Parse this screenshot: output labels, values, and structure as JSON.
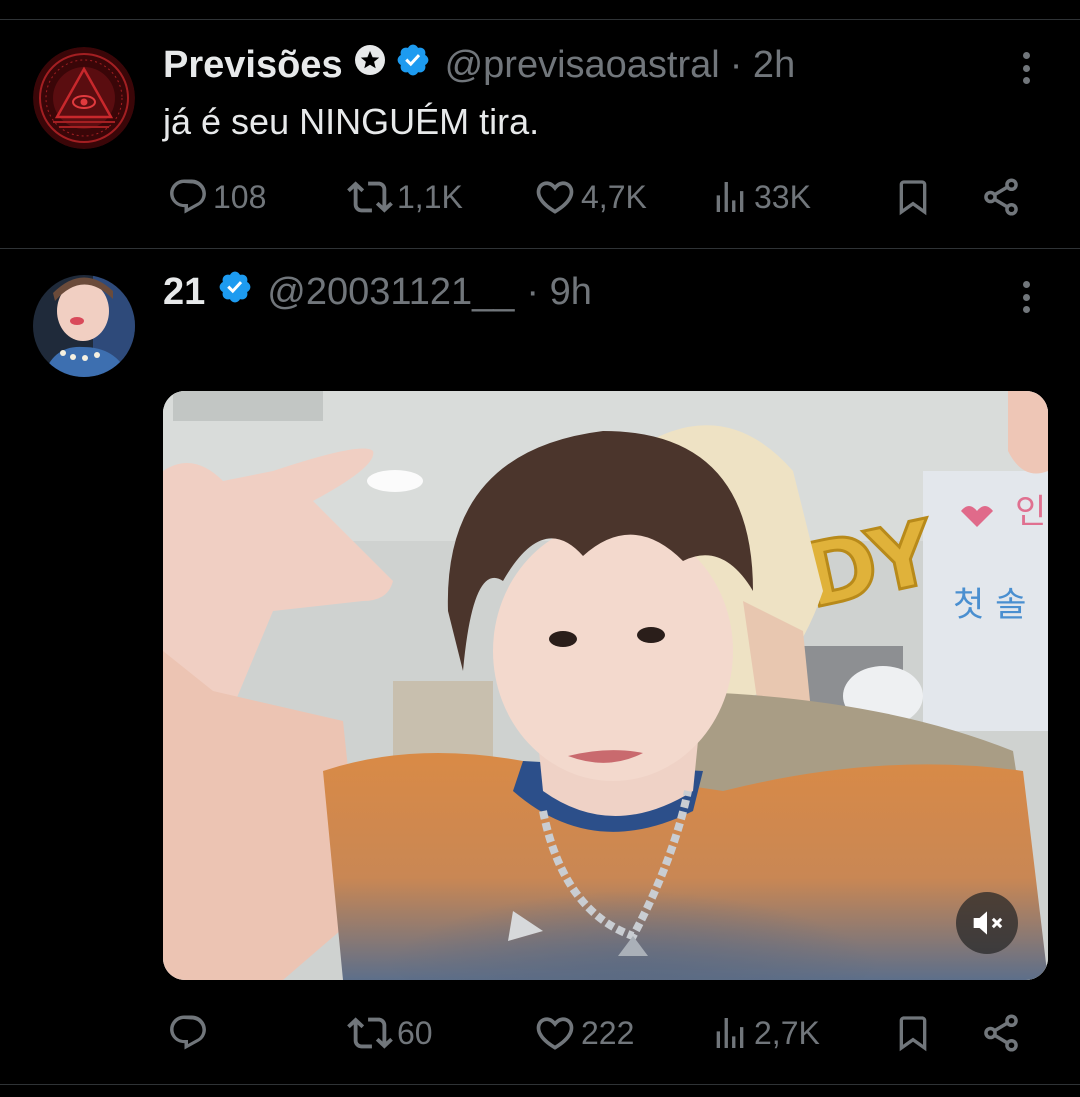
{
  "tweets": [
    {
      "author_name": "Previsões",
      "handle": "@previsaoastral",
      "time": "· 2h",
      "text": "já é seu NINGUÉM tira.",
      "replies": "108",
      "reposts": "1,1K",
      "likes": "4,7K",
      "views": "33K"
    },
    {
      "author_name": "21",
      "handle": "@20031121__",
      "time": "· 9h",
      "replies": "",
      "reposts": "60",
      "likes": "222",
      "views": "2,7K",
      "media": {
        "type": "video",
        "balloon_letters": "DY",
        "sign_text_1": "인",
        "sign_text_2": "첫 솔"
      }
    }
  ],
  "colors": {
    "background": "#000000",
    "text_primary": "#e7e9ea",
    "text_secondary": "#71767b",
    "verified_blue": "#1d9bf0",
    "divider": "#2f3336",
    "avatar_red": "#8b1a1a"
  },
  "icons": {
    "reply": "reply-icon",
    "repost": "repost-icon",
    "like": "heart-icon",
    "views": "views-icon",
    "bookmark": "bookmark-icon",
    "share": "share-icon",
    "more": "more-icon",
    "verified": "verified-badge-icon",
    "affiliate": "star-badge-icon",
    "mute": "mute-icon"
  }
}
